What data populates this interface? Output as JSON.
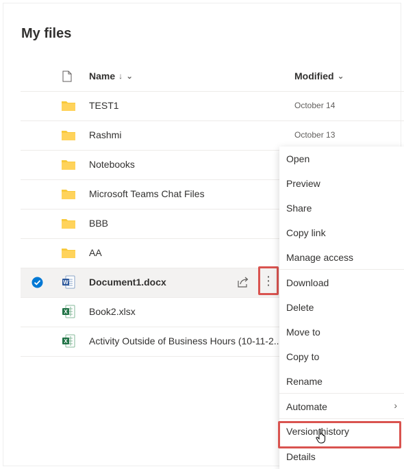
{
  "page": {
    "title": "My files"
  },
  "header": {
    "name_label": "Name",
    "name_sort": "↓",
    "name_chevron": "⌄",
    "modified_label": "Modified",
    "modified_chevron": "⌄"
  },
  "rows": [
    {
      "name": "TEST1",
      "modified": "October 14",
      "type": "folder"
    },
    {
      "name": "Rashmi",
      "modified": "October 13",
      "type": "folder"
    },
    {
      "name": "Notebooks",
      "modified": "",
      "type": "folder"
    },
    {
      "name": "Microsoft Teams Chat Files",
      "modified": "",
      "type": "folder"
    },
    {
      "name": "BBB",
      "modified": "",
      "type": "folder"
    },
    {
      "name": "AA",
      "modified": "",
      "type": "folder"
    },
    {
      "name": "Document1.docx",
      "modified": "",
      "type": "word",
      "selected": true
    },
    {
      "name": "Book2.xlsx",
      "modified": "",
      "type": "excel"
    },
    {
      "name": "Activity Outside of Business Hours (10-11-2...",
      "modified": "",
      "type": "excel"
    }
  ],
  "context_menu": {
    "items": [
      "Open",
      "Preview",
      "Share",
      "Copy link",
      "Manage access",
      "Download",
      "Delete",
      "Move to",
      "Copy to",
      "Rename",
      "Automate",
      "Version history",
      "Details"
    ],
    "submenu_chevron": "›"
  },
  "colors": {
    "folder": "#f8c93b",
    "word": "#2b579a",
    "excel": "#217346",
    "check": "#0078d4",
    "highlight": "#d9534f"
  },
  "icons": [
    "file-type-icon",
    "folder-icon",
    "word-file-icon",
    "excel-file-icon",
    "share-icon",
    "more-actions-icon",
    "checkmark-icon",
    "hand-cursor-icon"
  ]
}
